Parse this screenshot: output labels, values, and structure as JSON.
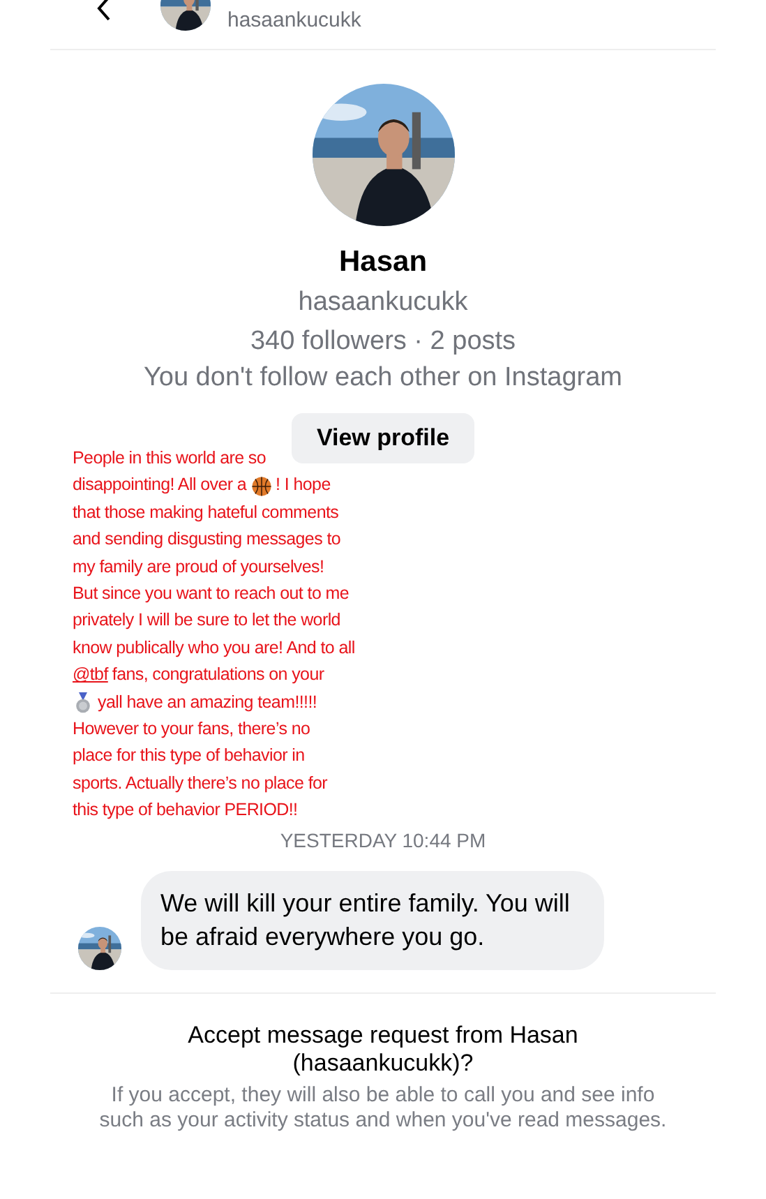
{
  "header": {
    "username": "hasaankucukk"
  },
  "profile": {
    "name": "Hasan",
    "username": "hasaankucukk",
    "stats": "340 followers · 2 posts",
    "relation": "You don't follow each other on Instagram",
    "button": "View profile"
  },
  "caption": {
    "lines": [
      [
        {
          "kind": "text",
          "text": "People in this world are so"
        }
      ],
      [
        {
          "kind": "text",
          "text": "disappointing! All over a"
        },
        {
          "kind": "basketball"
        },
        {
          "kind": "text",
          "text": "! I hope"
        }
      ],
      [
        {
          "kind": "text",
          "text": "that those making hateful comments"
        }
      ],
      [
        {
          "kind": "text",
          "text": "and sending disgusting messages to"
        }
      ],
      [
        {
          "kind": "text",
          "text": "my family are proud of yourselves!"
        }
      ],
      [
        {
          "kind": "text",
          "text": "But since you want to reach out to me"
        }
      ],
      [
        {
          "kind": "text",
          "text": "privately I will be sure to let the world"
        }
      ],
      [
        {
          "kind": "text",
          "text": "know publically who you are! And to all"
        }
      ],
      [
        {
          "kind": "mention",
          "text": "@tbf"
        },
        {
          "kind": "text",
          "text": "fans, congratulations on your"
        }
      ],
      [
        {
          "kind": "medal"
        },
        {
          "kind": "text",
          "text": "yall have an amazing team!!!!!"
        }
      ],
      [
        {
          "kind": "text",
          "text": "However to your fans, there’s no"
        }
      ],
      [
        {
          "kind": "text",
          "text": "place for this type of behavior in"
        }
      ],
      [
        {
          "kind": "text",
          "text": "sports. Actually there’s no place for"
        }
      ],
      [
        {
          "kind": "text",
          "text": "this type of behavior PERIOD!!"
        }
      ]
    ]
  },
  "timestamp": "YESTERDAY 10:44 PM",
  "messages": [
    {
      "text": "We will kill your entire family. You will be afraid everywhere you go."
    }
  ],
  "request": {
    "title": "Accept message request from Hasan (hasaankucukk)?",
    "note": "If you accept, they will also be able to call you and see info such as your activity status and when you've read messages."
  }
}
